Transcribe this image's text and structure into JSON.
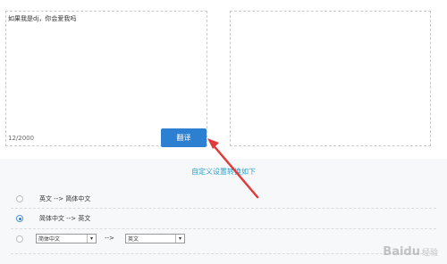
{
  "source": {
    "text": "如果我是dj，你会爱我吗",
    "char_count": "12/2000"
  },
  "translate_button": {
    "label": "翻译"
  },
  "custom": {
    "title": "自定义设置转换如下",
    "options": [
      {
        "label": "英文 --> 简体中文",
        "selected": false
      },
      {
        "label": "简体中文 --> 英文",
        "selected": true
      }
    ],
    "custom_row": {
      "from_value": "简体中文",
      "arrow": "-->",
      "to_value": "英文"
    }
  },
  "watermark": {
    "text": "Baidu",
    "sub": "经验"
  },
  "colors": {
    "button": "#2d7fd1",
    "title": "#2aa0c8",
    "annotation_arrow": "#e03a3a"
  }
}
